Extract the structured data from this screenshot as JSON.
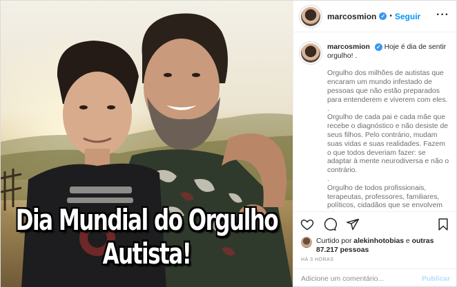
{
  "photo": {
    "overlay_text": "Dia Mundial do Orgulho Autista!"
  },
  "header": {
    "username": "marcosmion",
    "separator": "•",
    "follow_label": "Seguir",
    "more_icon": "more-horizontal-icon"
  },
  "caption": {
    "username": "marcosmion",
    "first_line": "Hoje é dia de sentir orgulho! .",
    "paragraphs": [
      "Orgulho dos milhões de autistas que encaram um mundo infestado de pessoas que não estão preparados para entenderem e viverem com eles.",
      ".",
      "Orgulho de cada pai e cada mãe que recebe o diagnóstico e não desiste de seus filhos. Pelo contrário, mudam suas vidas e suas realidades. Fazem o que todos deveriam fazer: se adaptar à mente neurodiversa e não o contrário.",
      ".",
      "Orgulho de todos profissionais, terapeutas, professores, familiares, políticos, cidadãos que se envolvem"
    ]
  },
  "actions": {
    "like_icon": "heart-icon",
    "comment_icon": "comment-icon",
    "share_icon": "share-icon",
    "save_icon": "bookmark-icon"
  },
  "likes": {
    "prefix": "Curtido por ",
    "liker": "alekinhotobias",
    "middle": " e ",
    "others": "outras 87.217 pessoas"
  },
  "timestamp": "HÁ 3 HORAS",
  "add_comment": {
    "placeholder": "Adicione um comentário...",
    "publish_label": "Publicar"
  },
  "colors": {
    "accent": "#0095f6",
    "verified": "#3897f0",
    "publish_disabled": "#b2dffc"
  }
}
